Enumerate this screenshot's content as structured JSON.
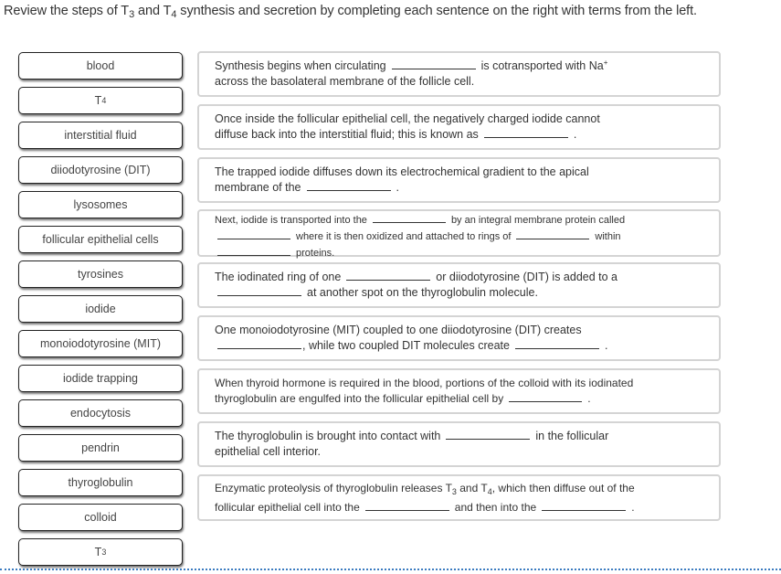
{
  "instructions": {
    "part1": "Review the steps of T",
    "sub1": "3",
    "part2": " and T",
    "sub2": "4",
    "part3": " synthesis and secretion by completing each sentence on the right with terms from the left."
  },
  "terms": [
    {
      "label": "blood"
    },
    {
      "label": "T",
      "sub": "4"
    },
    {
      "label": "interstitial fluid"
    },
    {
      "label": "diiodotyrosine (DIT)"
    },
    {
      "label": "lysosomes"
    },
    {
      "label": "follicular epithelial cells"
    },
    {
      "label": "tyrosines"
    },
    {
      "label": "iodide"
    },
    {
      "label": "monoiodotyrosine (MIT)"
    },
    {
      "label": "iodide trapping"
    },
    {
      "label": "endocytosis"
    },
    {
      "label": "pendrin"
    },
    {
      "label": "thyroglobulin"
    },
    {
      "label": "colloid"
    },
    {
      "label": "T",
      "sub": "3"
    }
  ],
  "statements": {
    "s1": {
      "a": "Synthesis begins when circulating",
      "b": "is cotransported with Na",
      "sup": "+",
      "c": "across the basolateral membrane of the follicle cell."
    },
    "s2": {
      "a": "Once inside the follicular epithelial cell, the negatively charged iodide cannot",
      "b": "diffuse back into the interstitial fluid; this is known as",
      "c": "."
    },
    "s3": {
      "a": "The trapped iodide diffuses down its electrochemical gradient to the apical",
      "b": "membrane of the",
      "c": "."
    },
    "s4": {
      "a": "Next, iodide is transported into the",
      "b": "by an integral membrane protein called",
      "c": "where it is then oxidized and attached to rings of",
      "d": "within",
      "e": "proteins."
    },
    "s5": {
      "a": "The iodinated ring of one",
      "b": "or diiodotyrosine (DIT) is added to a",
      "c": "at another spot on the thyroglobulin molecule."
    },
    "s6": {
      "a": "One monoiodotyrosine (MIT) coupled to one diiodotyrosine (DIT) creates",
      "b": ", while two coupled DIT molecules create",
      "c": "."
    },
    "s7": {
      "a": "When thyroid hormone is required in the blood, portions of the colloid with its iodinated",
      "b": "thyroglobulin are engulfed into the follicular epithelial cell by",
      "c": "."
    },
    "s8": {
      "a": "The thyroglobulin is brought into contact with",
      "b": "in the follicular",
      "c": "epithelial cell interior."
    },
    "s9": {
      "a": "Enzymatic proteolysis of thyroglobulin releases T",
      "sub1": "3",
      "a2": " and T",
      "sub2": "4",
      "a3": ", which then diffuse out of the",
      "b": "follicular epithelial cell into the",
      "c": "and then into the",
      "d": "."
    }
  },
  "colors": {
    "divider": "#3b7bc0",
    "statement_border": "#d4d4d4",
    "term_border": "#222222"
  }
}
